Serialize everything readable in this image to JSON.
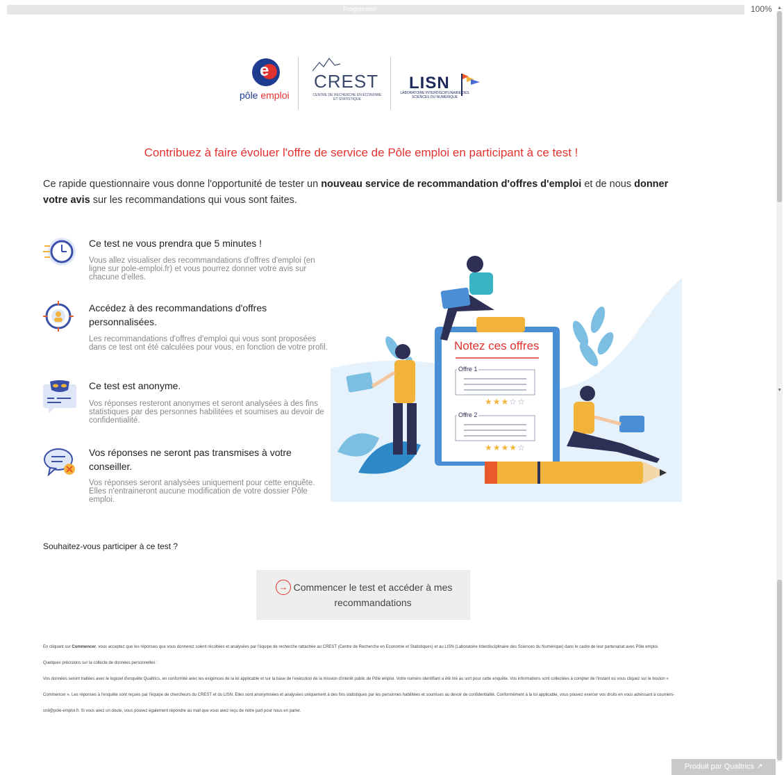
{
  "progress": {
    "label": "Progression",
    "percent_text": "100%",
    "value": 1.0
  },
  "logos": {
    "pole_emploi": {
      "part1": "pôle",
      "part2": "emploi"
    },
    "crest": {
      "name": "CREST",
      "subtitle": "CENTRE DE RECHERCHE EN ÉCONOMIE ET STATISTIQUE"
    },
    "lisn": {
      "name": "LISN",
      "subtitle": "LABORATOIRE INTERDISCIPLINAIRE DES SCIENCES DU NUMÉRIQUE"
    }
  },
  "headline": "Contribuez à faire évoluer l'offre de service de Pôle emploi en participant à ce test !",
  "intro": {
    "part1": "Ce rapide questionnaire vous donne l'opportunité de tester un ",
    "bold1": "nouveau service de recommandation d'offres d'emploi",
    "part2": " et de nous ",
    "bold2": "donner votre avis",
    "part3": " sur les recommandations qui vous sont faites."
  },
  "features": [
    {
      "icon": "clock-icon",
      "title": "Ce test ne vous prendra que 5 minutes !",
      "desc": "Vous allez visualiser des recommandations d'offres d'emploi (en ligne sur pole-emploi.fr) et vous pourrez donner votre avis sur chacune d'elles."
    },
    {
      "icon": "target-profile-icon",
      "title": "Accédez à des recommandations d'offres personnalisées.",
      "desc": "Les recommandations d'offres d'emploi qui vous sont proposées dans ce test ont été calculées pour vous, en fonction de votre profil."
    },
    {
      "icon": "mask-icon",
      "title": "Ce test est anonyme.",
      "desc": "Vos réponses resteront anonymes et seront analysées à des fins statistiques par des personnes habilitées et soumises au devoir de confidentialité."
    },
    {
      "icon": "chat-blocked-icon",
      "title": "Vos réponses ne seront pas transmises à votre conseiller.",
      "desc": "Vos réponses seront analysées uniquement pour cette enquête. Elles n'entraineront aucune modification de votre dossier Pôle emploi."
    }
  ],
  "illustration": {
    "board_title": "Notez ces offres",
    "offer1": "Offre 1",
    "offer2": "Offre 2",
    "offer1_stars": 3,
    "offer2_stars": 4,
    "max_stars": 5
  },
  "question": "Souhaitez-vous participer à ce test ?",
  "start_button": {
    "label": "Commencer le test et accéder à mes recommandations"
  },
  "legal": {
    "p1_a": "En cliquant sur ",
    "p1_bold": "Commencer",
    "p1_b": ", vous acceptez que les réponses que vous donnerez soient récoltées et analysées par l'équipe de recherche rattachée au CREST (Centre de Recherche en Economie et Statistiques) et au LISN (Laboratoire Interdisciplinaire des Sciences du Numérique) dans le cadre de leur partenariat avec Pôle emploi.",
    "p2": "Quelques précisions sur la collecte de données personnelles :",
    "p3": "Vos données seront traitées avec le logiciel d'enquête Qualtrics, en conformité avec les exigences de la loi applicable et sur la base de l'exécution de la mission d'intérêt public de Pôle emploi. Votre numéro identifiant a été tiré au sort pour cette enquête. Vos informations sont collectées à compter de l'instant où vous cliquez sur le bouton « Commencer ». Les réponses à l'enquête sont reçues par l'équipe de chercheurs du CREST et du LISN. Elles sont anonymisées et analysées uniquement à des fins statistiques par les personnes habilitées et soumises au devoir de confidentialité. Conformément à la loi applicable, vous pouvez exercer vos droits en vous adressant à courriers-cnil@pole-emploi.fr. Si vous avez un doute, vous pouvez également répondre au mail que vous avez reçu de notre part pour nous en parler."
  },
  "footer": {
    "qualtrics": "Produit par Qualtrics ↗"
  },
  "colors": {
    "accent_red": "#e2322f",
    "navy": "#1d3c8f",
    "button_bg": "#eeeeee"
  }
}
